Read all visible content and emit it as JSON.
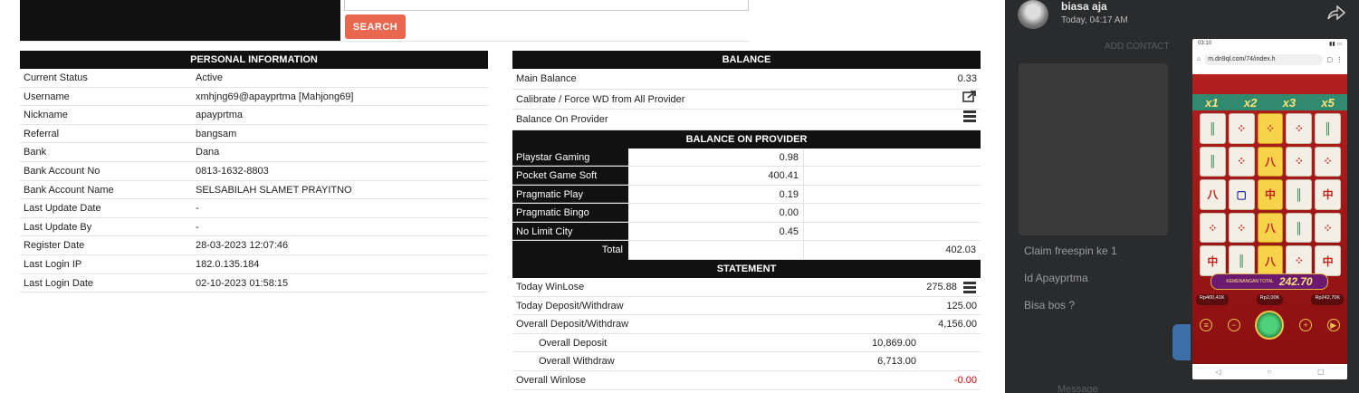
{
  "search": {
    "button_label": "SEARCH"
  },
  "personal": {
    "title": "PERSONAL INFORMATION",
    "rows": [
      {
        "label": "Current Status",
        "value": "Active"
      },
      {
        "label": "Username",
        "value": "xmhjng69@apayprtma  [Mahjong69]"
      },
      {
        "label": "Nickname",
        "value": "apayprtma"
      },
      {
        "label": "Referral",
        "value": "bangsam"
      },
      {
        "label": "Bank",
        "value": "Dana"
      },
      {
        "label": "Bank Account No",
        "value": "0813-1632-8803"
      },
      {
        "label": "Bank Account Name",
        "value": "SELSABILAH SLAMET PRAYITNO"
      },
      {
        "label": "Last Update Date",
        "value": "-"
      },
      {
        "label": "Last Update By",
        "value": "-"
      },
      {
        "label": "Register Date",
        "value": "28-03-2023 12:07:46"
      },
      {
        "label": "Last Login IP",
        "value": "182.0.135.184"
      },
      {
        "label": "Last Login Date",
        "value": "02-10-2023 01:58:15"
      }
    ]
  },
  "balance": {
    "title": "BALANCE",
    "main_label": "Main Balance",
    "main_value": "0.33",
    "calibrate_label": "Calibrate / Force WD from All Provider",
    "on_provider_label": "Balance On Provider"
  },
  "providers": {
    "title": "BALANCE ON PROVIDER",
    "rows": [
      {
        "name": "Playstar Gaming",
        "value": "0.98"
      },
      {
        "name": "Pocket Game Soft",
        "value": "400.41"
      },
      {
        "name": "Pragmatic Play",
        "value": "0.19"
      },
      {
        "name": "Pragmatic Bingo",
        "value": "0.00"
      },
      {
        "name": "No Limit City",
        "value": "0.45"
      }
    ],
    "total_label": "Total",
    "total_value": "402.03"
  },
  "statement": {
    "title": "STATEMENT",
    "today_winlose_label": "Today WinLose",
    "today_winlose_value": "275.88",
    "today_dw_label": "Today Deposit/Withdraw",
    "today_dw_value": "125.00",
    "overall_dw_label": "Overall Deposit/Withdraw",
    "overall_dw_value": "4,156.00",
    "overall_deposit_label": "Overall Deposit",
    "overall_deposit_value": "10,869.00",
    "overall_withdraw_label": "Overall Withdraw",
    "overall_withdraw_value": "6,713.00",
    "overall_winlose_label": "Overall Winlose",
    "overall_winlose_value": "-0.00",
    "negative_color": "#e00000"
  },
  "chat": {
    "name": "biasa aja",
    "time": "Today, 04:17 AM",
    "add_contact": "ADD CONTACT",
    "messages": [
      "Claim freespin ke 1",
      "Id Apayprtma",
      "Bisa bos ?"
    ],
    "message_placeholder": "Message"
  },
  "phone": {
    "status_time": "03:10",
    "url": "m.dn9ql.com/74/index.h",
    "multipliers": [
      "x1",
      "x2",
      "x3",
      "x5"
    ],
    "win_label": "KEMENANGAN TOTAL",
    "win_value": "242.70",
    "stats": [
      "Rp400,41K",
      "Rp2,00K",
      "Rp242,70K"
    ]
  },
  "colors": {
    "search_button": "#e8674e",
    "header_bg": "#111111",
    "chat_bg": "#2a2b2d"
  }
}
